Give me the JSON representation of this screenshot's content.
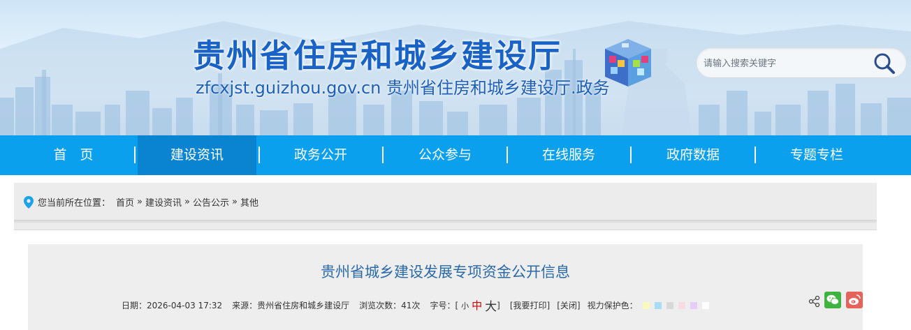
{
  "header": {
    "title": "贵州省住房和城乡建设厅",
    "subtitle": "zfcxjst.guizhou.gov.cn 贵州省住房和城乡建设厅.政务",
    "search_placeholder": "请输入搜索关键字"
  },
  "nav": {
    "items": [
      {
        "label": "首　页",
        "active": false
      },
      {
        "label": "建设资讯",
        "active": true
      },
      {
        "label": "政务公开",
        "active": false
      },
      {
        "label": "公众参与",
        "active": false
      },
      {
        "label": "在线服务",
        "active": false
      },
      {
        "label": "政府数据",
        "active": false
      },
      {
        "label": "专题专栏",
        "active": false
      }
    ],
    "separator": "|"
  },
  "breadcrumb": {
    "prefix": "您当前所在位置：",
    "items": [
      "首页",
      "建设资讯",
      "公告公示",
      "其他"
    ],
    "separator": "»"
  },
  "article": {
    "title": "贵州省城乡建设发展专项资金公开信息",
    "date_label": "日期：2026-04-03 17:32",
    "source_label": "来源：贵州省住房和城乡建设厅",
    "views_label": "浏览次数：41次",
    "fontsize_label": "字号：[",
    "fontsize_small": "小",
    "fontsize_mid": "中",
    "fontsize_big": "大",
    "fontsize_close": "]",
    "print_label": "[我要打印]",
    "close_label": "[关闭]",
    "eye_label": "视力保护色：",
    "eye_colors": [
      "#fafabe",
      "#aaddf5",
      "#d8d8d8",
      "#f5dce4",
      "#e6cdf5",
      "#ffffff"
    ]
  },
  "colors": {
    "nav_bg": "#0aa0ee",
    "nav_active": "#0a84d0",
    "title_blue": "#1a63c6",
    "article_title": "#2b6aa6"
  }
}
